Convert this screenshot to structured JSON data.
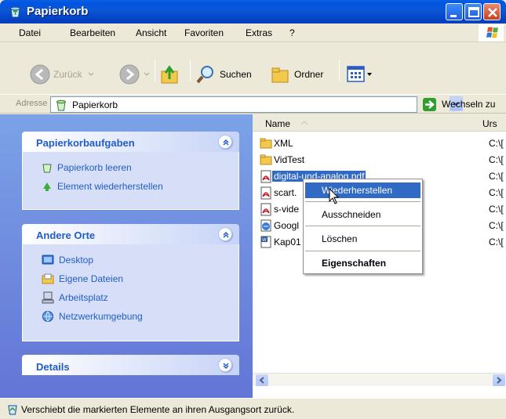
{
  "window": {
    "title": "Papierkorb"
  },
  "menubar": {
    "items": [
      "Datei",
      "Bearbeiten",
      "Ansicht",
      "Favoriten",
      "Extras",
      "?"
    ]
  },
  "toolbar": {
    "back_label": "Zurück",
    "search_label": "Suchen",
    "folders_label": "Ordner"
  },
  "addressbar": {
    "label": "Adresse",
    "value": "Papierkorb",
    "go_label": "Wechseln zu"
  },
  "sidebar": {
    "tasks": {
      "title": "Papierkorbaufgaben",
      "items": [
        "Papierkorb leeren",
        "Element wiederherstellen"
      ]
    },
    "places": {
      "title": "Andere Orte",
      "items": [
        "Desktop",
        "Eigene Dateien",
        "Arbeitsplatz",
        "Netzwerkumgebung"
      ]
    },
    "details": {
      "title": "Details"
    }
  },
  "filelist": {
    "columns": {
      "name": "Name",
      "origin": "Urs"
    },
    "rows": [
      {
        "name": "XML",
        "origin": "C:\\[",
        "icon": "folder-icon"
      },
      {
        "name": "VidTest",
        "origin": "C:\\[",
        "icon": "folder-icon"
      },
      {
        "name": "digital-und-analog.pdf",
        "origin": "C:\\[",
        "icon": "pdf-icon",
        "selected": true
      },
      {
        "name": "scart.",
        "origin": "C:\\[",
        "icon": "pdf-icon"
      },
      {
        "name": "s-vide",
        "origin": "C:\\[",
        "icon": "pdf-icon"
      },
      {
        "name": "Googl",
        "origin": "C:\\[",
        "icon": "html-icon"
      },
      {
        "name": "Kap01",
        "origin": "C:\\[",
        "icon": "word-icon"
      }
    ]
  },
  "context_menu": {
    "items": [
      "Wiederherstellen",
      "Ausschneiden",
      "Löschen",
      "Eigenschaften"
    ],
    "highlighted": "Wiederherstellen",
    "default": "Eigenschaften"
  },
  "statusbar": {
    "text": "Verschiebt die markierten Elemente an ihren Ausgangsort zurück."
  },
  "colors": {
    "titlebar": "#0054e3",
    "taskpane": "#6375d6",
    "selection": "#316ac5",
    "link": "#215dc6"
  }
}
